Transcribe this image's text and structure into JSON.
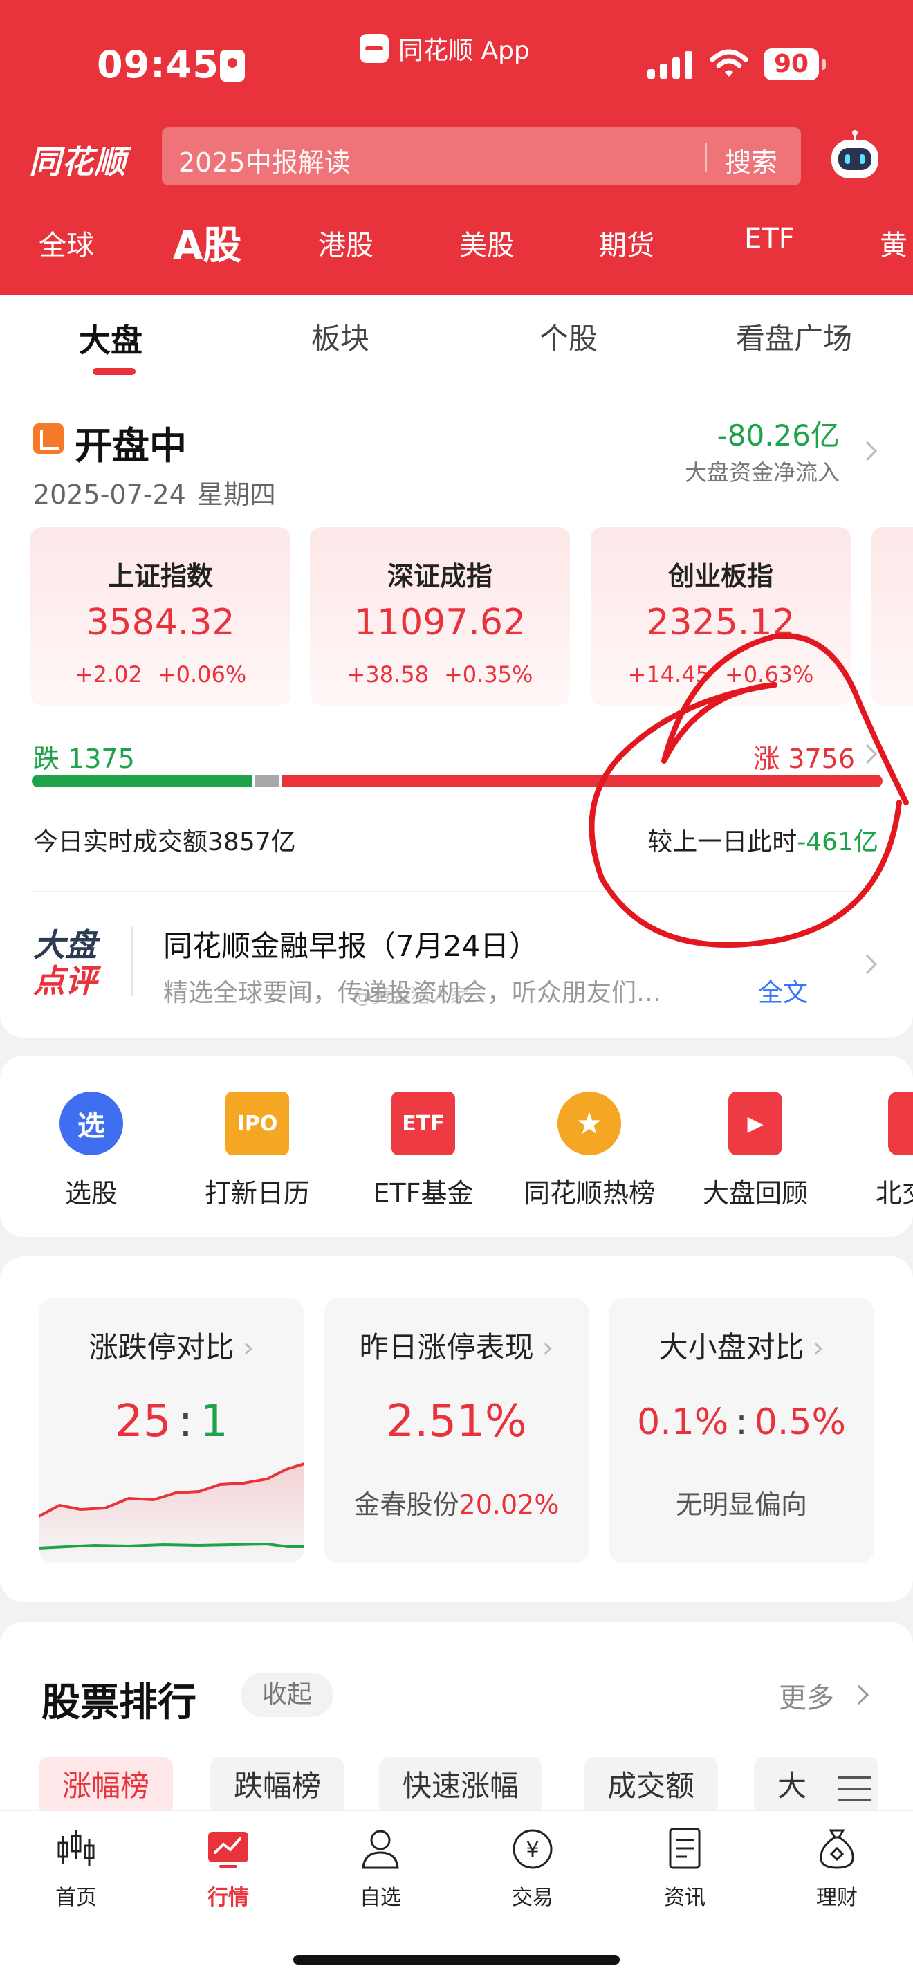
{
  "status_bar": {
    "time": "09:45",
    "app_name": "同花顺 App",
    "battery": "90"
  },
  "header": {
    "logo": "同花顺",
    "search_placeholder": "2025中报解读",
    "search_button": "搜索",
    "market_tabs": [
      "全球",
      "A股",
      "港股",
      "美股",
      "期货",
      "ETF",
      "黄"
    ],
    "active_market_tab": "A股"
  },
  "sub_tabs": [
    "大盘",
    "板块",
    "个股",
    "看盘广场"
  ],
  "market_status": {
    "state": "开盘中",
    "date": "2025-07-24",
    "weekday": "星期四",
    "net_flow_value": "-80.26亿",
    "net_flow_label": "大盘资金净流入"
  },
  "indices": [
    {
      "name": "上证指数",
      "value": "3584.32",
      "change": "+2.02",
      "pct": "+0.06%"
    },
    {
      "name": "深证成指",
      "value": "11097.62",
      "change": "+38.58",
      "pct": "+0.35%"
    },
    {
      "name": "创业板指",
      "value": "2325.12",
      "change": "+14.45",
      "pct": "+0.63%"
    }
  ],
  "breadth": {
    "fall_label": "跌 1375",
    "rise_label": "涨 3756",
    "fall": 1375,
    "flat_share": 0.028,
    "rise": 3756
  },
  "turnover": {
    "today_label": "今日实时成交额",
    "today_value": "3857亿",
    "compare_label": "较上一日此时",
    "compare_value": "-461亿"
  },
  "brief": {
    "logo_line1": "大盘",
    "logo_line2": "点评",
    "title": "同花顺金融早报（7月24日）",
    "desc": "精选全球要闻，传递投资机会，听众朋友们…",
    "more": "全文",
    "watermark": "@黄金猎人家"
  },
  "quick_entries": [
    {
      "label": "选股",
      "icon": "select-stock-icon",
      "glyph": "选",
      "color": "#3f6ff0"
    },
    {
      "label": "打新日历",
      "icon": "ipo-calendar-icon",
      "glyph": "IPO",
      "color": "#f5a623"
    },
    {
      "label": "ETF基金",
      "icon": "etf-fund-icon",
      "glyph": "ETF",
      "color": "#ee3a43"
    },
    {
      "label": "同花顺热榜",
      "icon": "hot-list-icon",
      "glyph": "★",
      "color": "#f5a623"
    },
    {
      "label": "大盘回顾",
      "icon": "market-review-icon",
      "glyph": "▶",
      "color": "#ee3a43"
    },
    {
      "label": "北交",
      "icon": "bse-icon",
      "glyph": "",
      "color": "#ee3a43"
    }
  ],
  "stats": {
    "limit": {
      "title": "涨跌停对比",
      "up": "25",
      "down": "1",
      "sep": ":"
    },
    "yesterday": {
      "title": "昨日涨停表现",
      "value": "2.51%",
      "stock": "金春股份",
      "stock_pct": "20.02%"
    },
    "cap": {
      "title": "大小盘对比",
      "large": "0.1%",
      "small": "0.5%",
      "sep": ":",
      "note": "无明显偏向"
    }
  },
  "ranking": {
    "title": "股票排行",
    "collapse": "收起",
    "more": "更多",
    "tabs": [
      "涨幅榜",
      "跌幅榜",
      "快速涨幅",
      "成交额",
      "大"
    ],
    "active_tab": "涨幅榜"
  },
  "bottom_nav": [
    "首页",
    "行情",
    "自选",
    "交易",
    "资讯",
    "理财"
  ],
  "active_nav": "行情",
  "colors": {
    "brand_red": "#e8333c",
    "rise": "#e8333c",
    "fall": "#1ea34a",
    "link": "#3478f6"
  }
}
